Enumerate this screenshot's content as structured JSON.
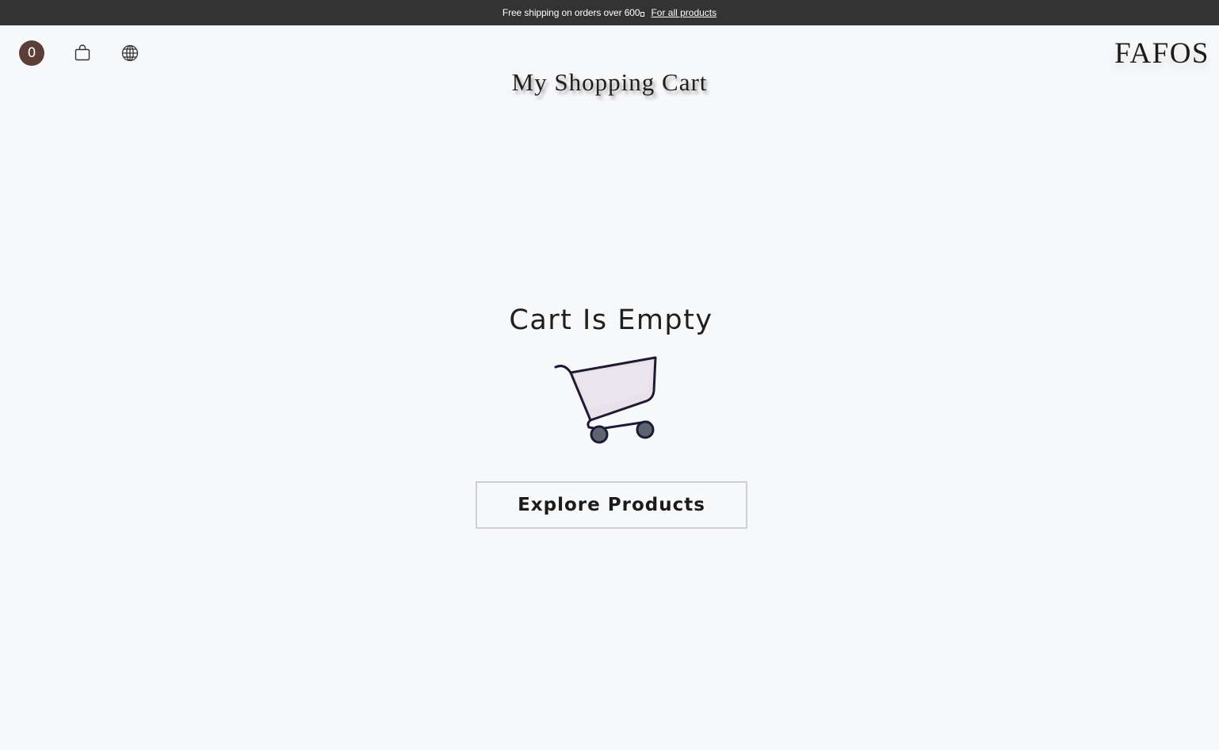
{
  "announcement": {
    "text": "Free shipping on orders over 600",
    "currency_icon": "currency-icon",
    "link_label": "For all products"
  },
  "header": {
    "cart_count": "0",
    "bag_icon": "shopping-bag-icon",
    "globe_icon": "globe-icon",
    "logo": "FAFOS"
  },
  "page": {
    "title": "My Shopping Cart"
  },
  "empty_state": {
    "heading": "Cart Is Empty",
    "illustration": "shopping-cart-icon",
    "button_label": "Explore Products"
  },
  "colors": {
    "topbar_bg": "#333333",
    "badge_bg": "#5b3f37",
    "page_bg": "#f7f8fa",
    "cart_fill": "#e8e1ea",
    "wheel_fill": "#5c6371"
  }
}
